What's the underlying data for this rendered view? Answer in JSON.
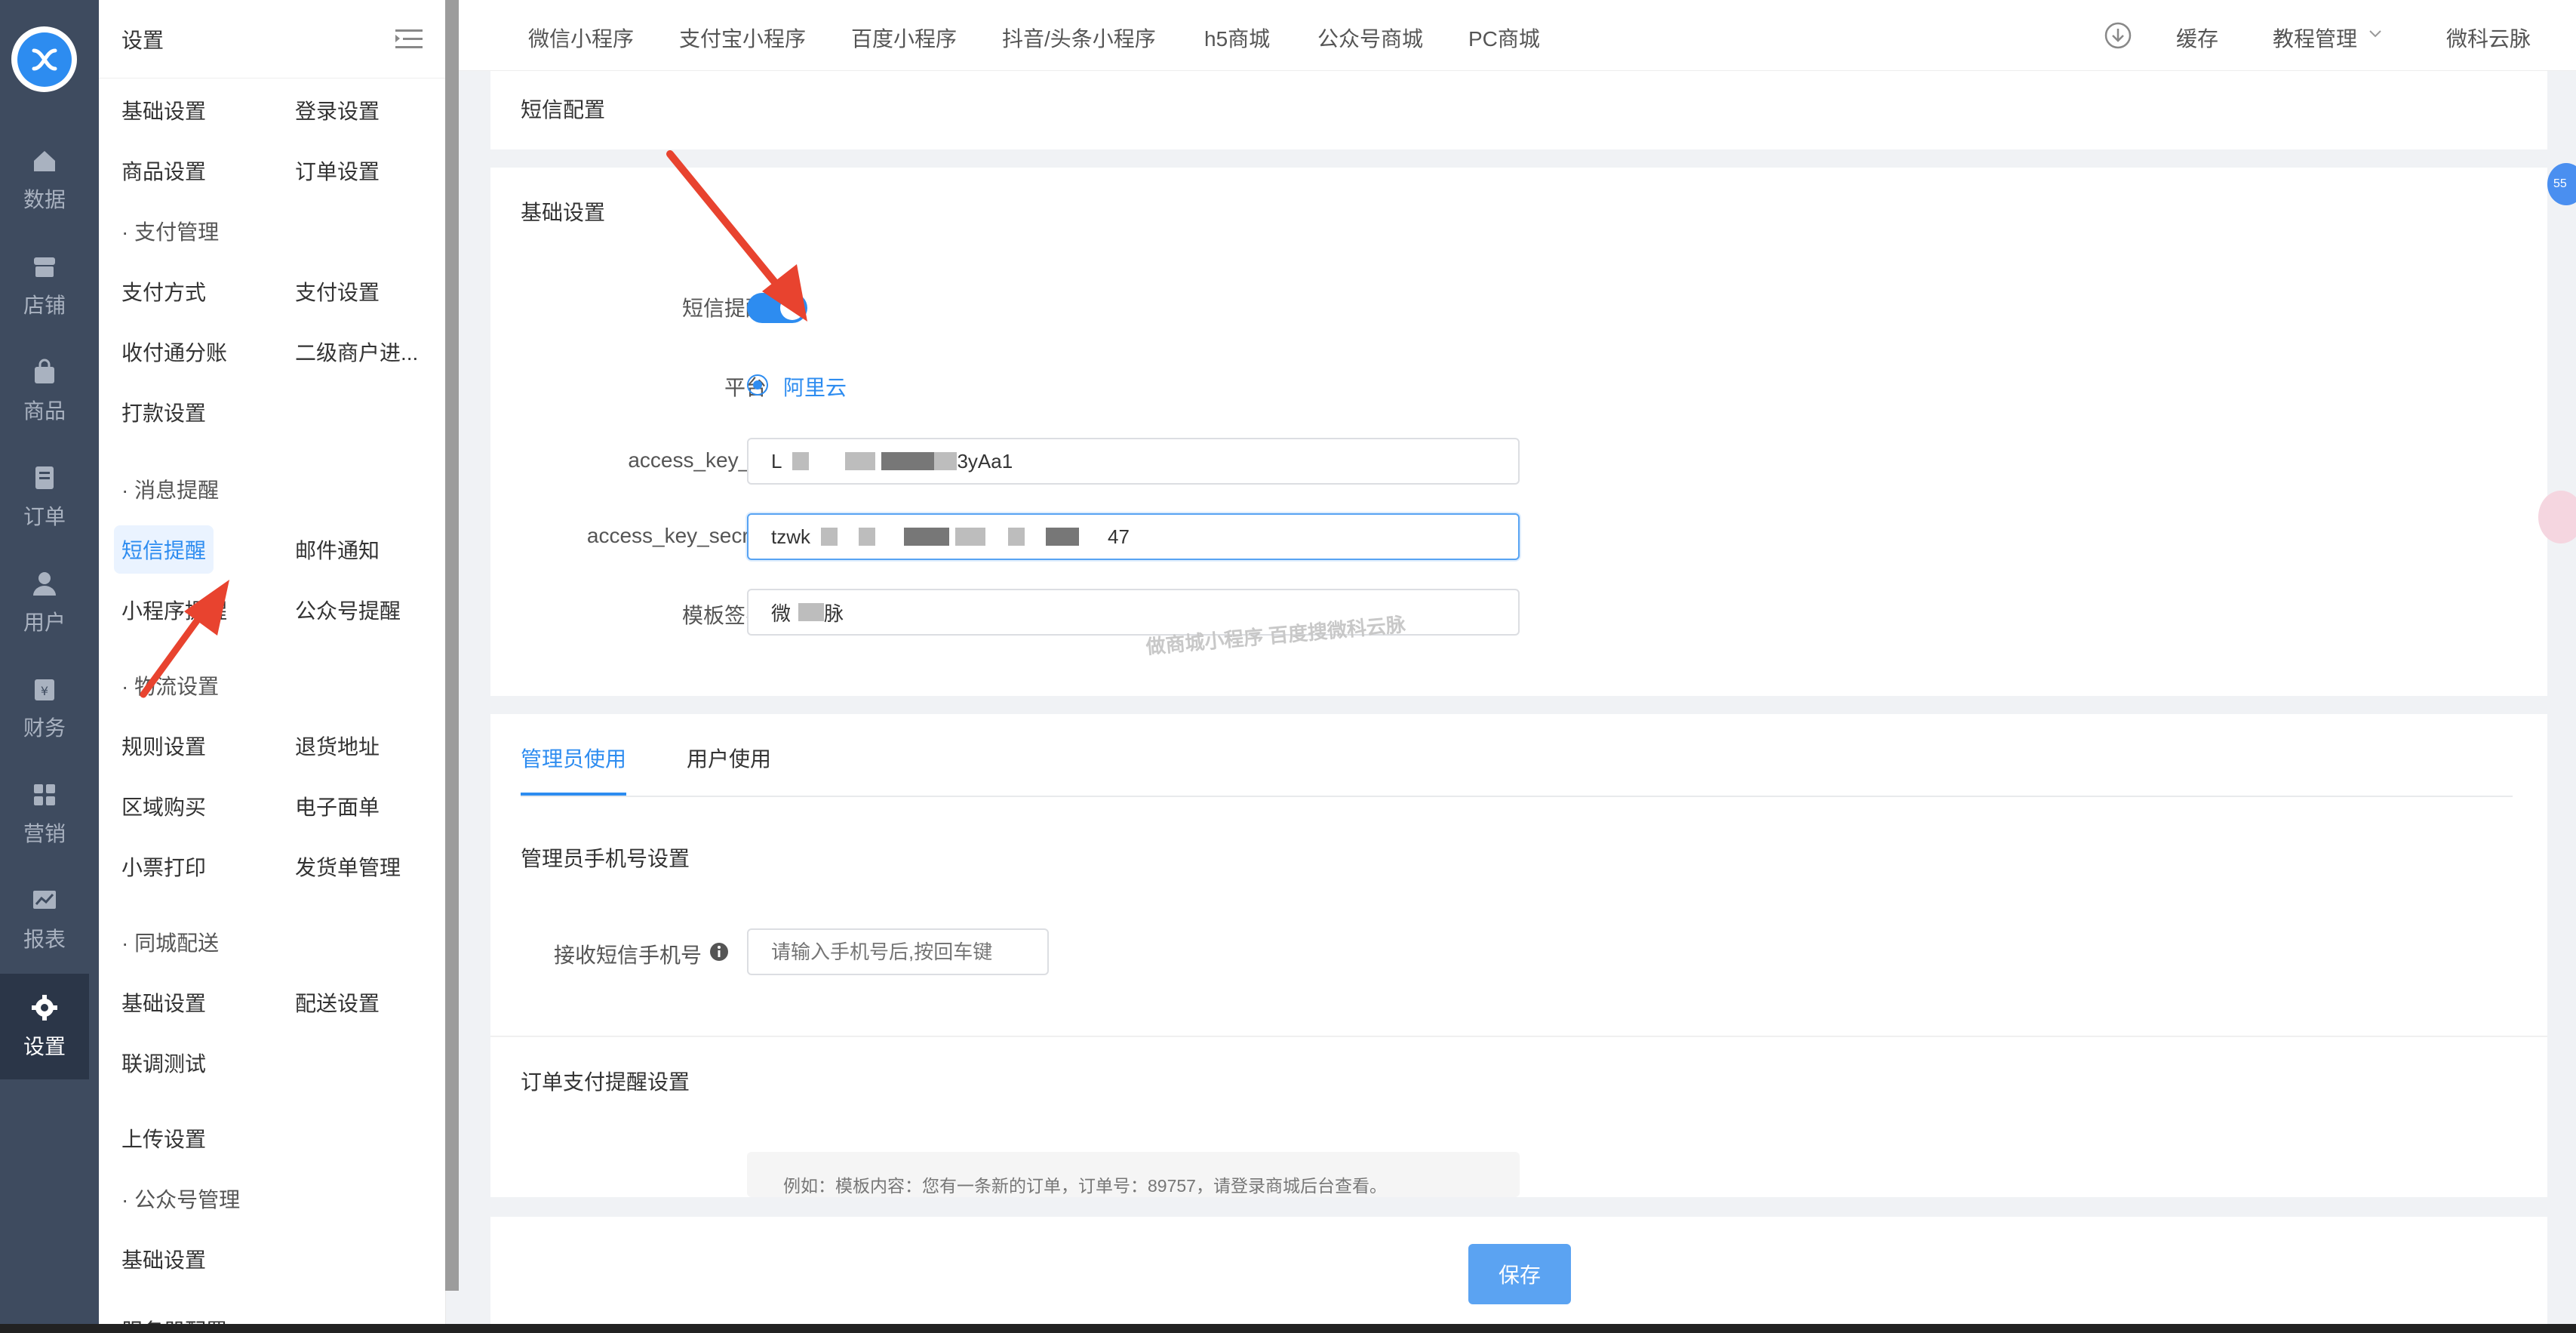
{
  "rail": {
    "items": [
      {
        "label": "数据",
        "icon": "home-icon"
      },
      {
        "label": "店铺",
        "icon": "store-icon"
      },
      {
        "label": "商品",
        "icon": "bag-icon"
      },
      {
        "label": "订单",
        "icon": "order-icon"
      },
      {
        "label": "用户",
        "icon": "user-icon"
      },
      {
        "label": "财务",
        "icon": "finance-icon"
      },
      {
        "label": "营销",
        "icon": "marketing-icon"
      },
      {
        "label": "报表",
        "icon": "chart-icon"
      },
      {
        "label": "设置",
        "icon": "gear-icon"
      }
    ]
  },
  "submenu": {
    "title": "设置",
    "items": {
      "basic": "基础设置",
      "login": "登录设置",
      "goods": "商品设置",
      "order": "订单设置",
      "pay_group": "· 支付管理",
      "pay_method": "支付方式",
      "pay_setting": "支付设置",
      "split": "收付通分账",
      "sub_merchant": "二级商户进...",
      "payout": "打款设置",
      "msg_group": "· 消息提醒",
      "sms": "短信提醒",
      "mail": "邮件通知",
      "mini_notice": "小程序提醒",
      "mp_notice": "公众号提醒",
      "logistics_group": "· 物流设置",
      "rules": "规则设置",
      "return_addr": "退货地址",
      "region": "区域购买",
      "e_waybill": "电子面单",
      "receipt": "小票打印",
      "ship_manage": "发货单管理",
      "city_group": "· 同城配送",
      "city_basic": "基础设置",
      "delivery": "配送设置",
      "joint_test": "联调测试",
      "upload": "上传设置",
      "mp_group": "· 公众号管理",
      "mp_basic": "基础设置",
      "server": "服务器配置"
    }
  },
  "topbar": {
    "tabs": [
      "微信小程序",
      "支付宝小程序",
      "百度小程序",
      "抖音/头条小程序",
      "h5商城",
      "公众号商城",
      "PC商城"
    ],
    "cache": "缓存",
    "tutorial": "教程管理",
    "user": "微科云脉"
  },
  "page": {
    "section_title": "短信配置",
    "basic_title": "基础设置",
    "sms_toggle_label": "短信提醒",
    "sms_toggle_on": true,
    "platform_label": "平台",
    "platform_value": "阿里云",
    "access_key_id_label": "access_key_id",
    "access_key_id_prefix": "L",
    "access_key_id_suffix": "3yAa1",
    "access_key_secret_label": "access_key_secret",
    "access_key_secret_prefix": "tzwk",
    "access_key_secret_suffix": "47",
    "template_sign_label": "模板签名",
    "template_sign_prefix": "微",
    "template_sign_suffix": "脉",
    "watermark": "做商城小程序 百度搜微科云脉",
    "tabs": [
      "管理员使用",
      "用户使用"
    ],
    "admin_phone_title": "管理员手机号设置",
    "phone_label": "接收短信手机号",
    "phone_placeholder": "请输入手机号后,按回车键",
    "order_pay_title": "订单支付提醒设置",
    "example_text": "例如：模板内容：您有一条新的订单，订单号：89757，请登录商城后台查看。",
    "save_label": "保存",
    "badge": "55"
  },
  "colors": {
    "accent": "#2d8cf0",
    "rail": "#3e4b5f",
    "arrow": "#e8432f"
  }
}
